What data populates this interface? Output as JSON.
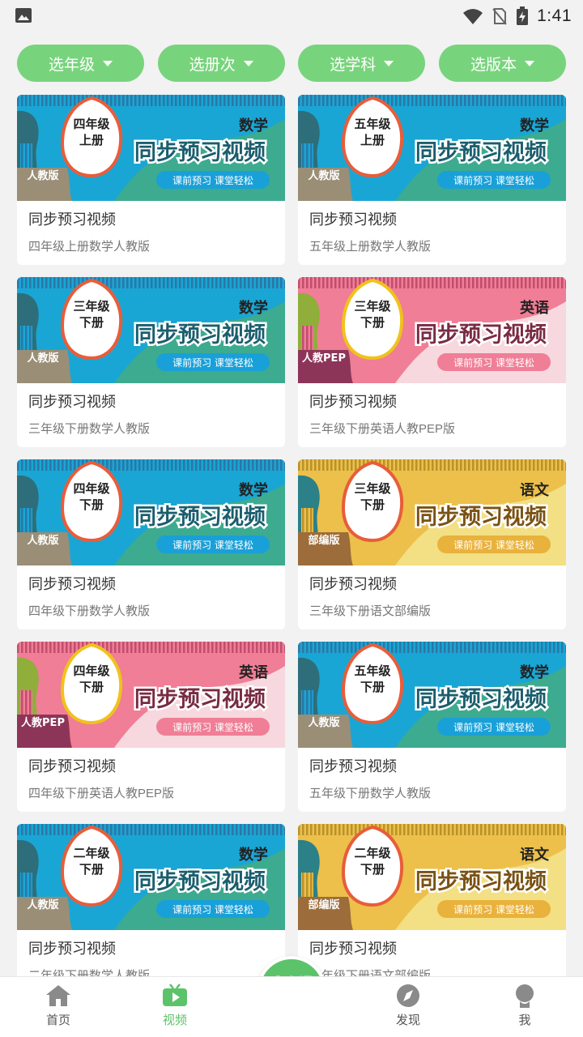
{
  "status_bar": {
    "time": "1:41"
  },
  "filters": [
    {
      "label": "选年级"
    },
    {
      "label": "选册次"
    },
    {
      "label": "选学科"
    },
    {
      "label": "选版本"
    }
  ],
  "banner_common": {
    "headline": "同步预习视频",
    "tagline": "课前预习 课堂轻松"
  },
  "cards": [
    {
      "grade": "四年级",
      "volume": "上册",
      "subject": "数学",
      "edition": "人教版",
      "theme": "math",
      "title": "同步预习视频",
      "subtitle": "四年级上册数学人教版"
    },
    {
      "grade": "五年级",
      "volume": "上册",
      "subject": "数学",
      "edition": "人教版",
      "theme": "math",
      "title": "同步预习视频",
      "subtitle": "五年级上册数学人教版"
    },
    {
      "grade": "三年级",
      "volume": "下册",
      "subject": "数学",
      "edition": "人教版",
      "theme": "math",
      "title": "同步预习视频",
      "subtitle": "三年级下册数学人教版"
    },
    {
      "grade": "三年级",
      "volume": "下册",
      "subject": "英语",
      "edition": "人教PEP",
      "theme": "english",
      "title": "同步预习视频",
      "subtitle": "三年级下册英语人教PEP版"
    },
    {
      "grade": "四年级",
      "volume": "下册",
      "subject": "数学",
      "edition": "人教版",
      "theme": "math",
      "title": "同步预习视频",
      "subtitle": "四年级下册数学人教版"
    },
    {
      "grade": "三年级",
      "volume": "下册",
      "subject": "语文",
      "edition": "部编版",
      "theme": "chinese",
      "title": "同步预习视频",
      "subtitle": "三年级下册语文部编版"
    },
    {
      "grade": "四年级",
      "volume": "下册",
      "subject": "英语",
      "edition": "人教PEP",
      "theme": "english",
      "title": "同步预习视频",
      "subtitle": "四年级下册英语人教PEP版"
    },
    {
      "grade": "五年级",
      "volume": "下册",
      "subject": "数学",
      "edition": "人教版",
      "theme": "math",
      "title": "同步预习视频",
      "subtitle": "五年级下册数学人教版"
    },
    {
      "grade": "二年级",
      "volume": "下册",
      "subject": "数学",
      "edition": "人教版",
      "theme": "math",
      "title": "同步预习视频",
      "subtitle": "二年级下册数学人教版"
    },
    {
      "grade": "二年级",
      "volume": "下册",
      "subject": "语文",
      "edition": "部编版",
      "theme": "chinese",
      "title": "同步预习视频",
      "subtitle": "二年级下册语文部编版"
    }
  ],
  "bottom_nav": {
    "items": [
      {
        "label": "首页",
        "icon": "home-icon"
      },
      {
        "label": "视频",
        "icon": "video-icon",
        "active": true
      },
      {
        "label": "发现",
        "icon": "compass-icon"
      },
      {
        "label": "我",
        "icon": "profile-icon"
      }
    ],
    "center": {
      "main": "拍",
      "small_top": "课",
      "small_bottom": "本"
    }
  },
  "colors": {
    "accent": "#78d47c",
    "math": {
      "bg": "#1aa6d4",
      "wave": "#3dab8f",
      "stripe": "#2878a8",
      "dark": "#2e6e7a",
      "badge": "#9a8e76",
      "border": "#e85d3a",
      "text": "#1b5e6e",
      "pill": "#19a0d8"
    },
    "english": {
      "bg": "#ef7e96",
      "wave": "#f7d8de",
      "stripe": "#c24e6e",
      "dark": "#8fae3a",
      "badge": "#8d3558",
      "border": "#f0c21a",
      "text": "#7a2b44",
      "pill": "#ef7e96"
    },
    "chinese": {
      "bg": "#ecc04a",
      "wave": "#f3df84",
      "stripe": "#b9922c",
      "dark": "#2c8087",
      "badge": "#9c6c3a",
      "border": "#e85d3a",
      "text": "#7a5214",
      "pill": "#e9b23c"
    }
  }
}
